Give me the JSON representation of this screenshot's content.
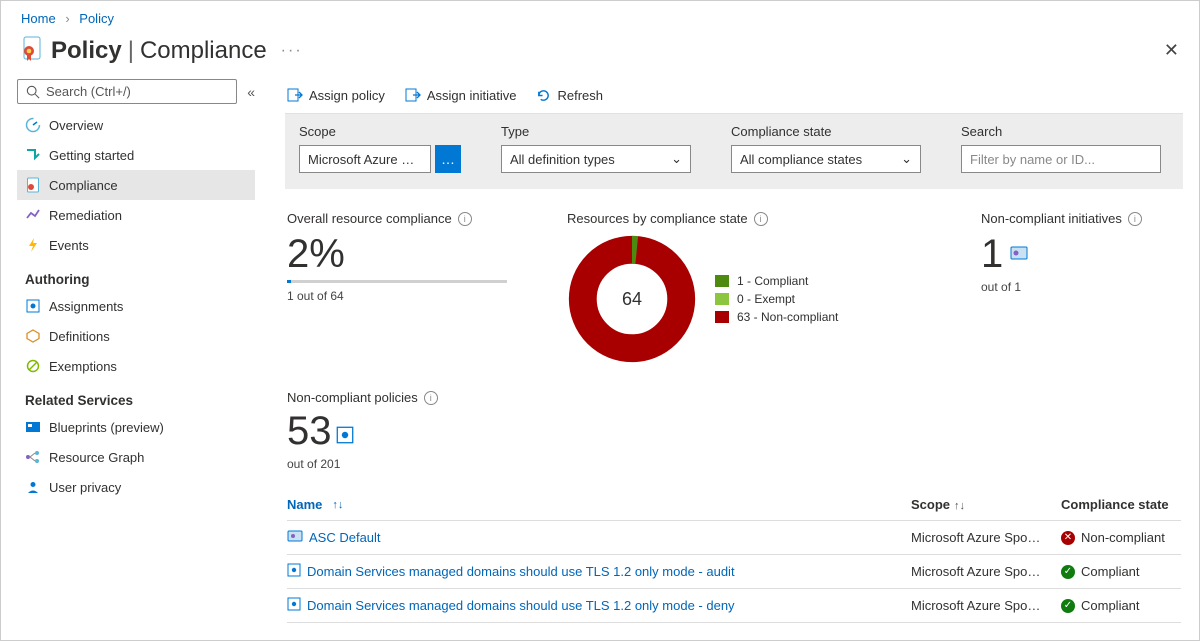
{
  "breadcrumb": {
    "home": "Home",
    "policy": "Policy"
  },
  "page": {
    "title_strong": "Policy",
    "title_sub": "Compliance",
    "more": "···"
  },
  "sidebar": {
    "search_placeholder": "Search (Ctrl+/)",
    "items": [
      "Overview",
      "Getting started",
      "Compliance",
      "Remediation",
      "Events"
    ],
    "group_authoring": "Authoring",
    "authoring_items": [
      "Assignments",
      "Definitions",
      "Exemptions"
    ],
    "group_related": "Related Services",
    "related_items": [
      "Blueprints (preview)",
      "Resource Graph",
      "User privacy"
    ]
  },
  "toolbar": {
    "assign_policy": "Assign policy",
    "assign_initiative": "Assign initiative",
    "refresh": "Refresh"
  },
  "filters": {
    "scope_label": "Scope",
    "scope_value": "Microsoft Azure …",
    "type_label": "Type",
    "type_value": "All definition types",
    "state_label": "Compliance state",
    "state_value": "All compliance states",
    "search_label": "Search",
    "search_placeholder": "Filter by name or ID..."
  },
  "stats": {
    "overall_label": "Overall resource compliance",
    "overall_pct": "2%",
    "overall_sub": "1 out of 64",
    "donut_label": "Resources by compliance state",
    "donut_center": "64",
    "legend_compliant": "1 - Compliant",
    "legend_exempt": "0 - Exempt",
    "legend_noncompliant": "63 - Non-compliant",
    "init_label": "Non-compliant initiatives",
    "init_num": "1",
    "init_sub": "out of 1"
  },
  "ncpolicies": {
    "label": "Non-compliant policies",
    "num": "53",
    "sub": "out of 201"
  },
  "table": {
    "col_name": "Name",
    "col_scope": "Scope",
    "col_state": "Compliance state",
    "rows": [
      {
        "name": "ASC Default",
        "scope": "Microsoft Azure Spo…",
        "state": "Non-compliant",
        "ok": false,
        "type": "initiative"
      },
      {
        "name": "Domain Services managed domains should use TLS 1.2 only mode - audit",
        "scope": "Microsoft Azure Spo…",
        "state": "Compliant",
        "ok": true,
        "type": "policy"
      },
      {
        "name": "Domain Services managed domains should use TLS 1.2 only mode - deny",
        "scope": "Microsoft Azure Spo…",
        "state": "Compliant",
        "ok": true,
        "type": "policy"
      }
    ]
  },
  "chart_data": {
    "type": "pie",
    "title": "Resources by compliance state",
    "total": 64,
    "series": [
      {
        "name": "Compliant",
        "value": 1,
        "color": "#4f8a10"
      },
      {
        "name": "Exempt",
        "value": 0,
        "color": "#8cc63f"
      },
      {
        "name": "Non-compliant",
        "value": 63,
        "color": "#a80000"
      }
    ]
  },
  "colors": {
    "accent": "#0078d4",
    "link": "#0066b8",
    "bad": "#a80000",
    "good": "#107c10"
  }
}
